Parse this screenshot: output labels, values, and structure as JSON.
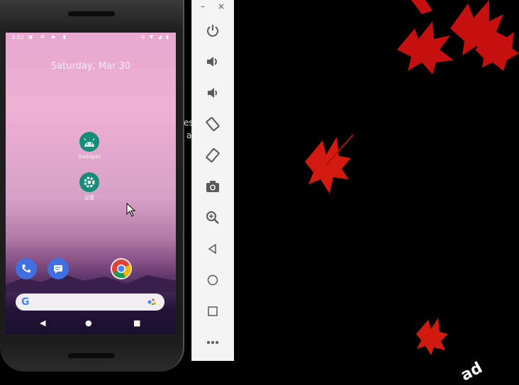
{
  "window": {
    "minimize_label": "–",
    "close_label": "×"
  },
  "desktop": {
    "partial_text_1": "es",
    "partial_text_2": "a",
    "watermark_fragment": "ad",
    "background_color": "#000000",
    "leaf_color": "#d01010"
  },
  "phone": {
    "status": {
      "time": "3:02",
      "left_icons": [
        "notification-icon",
        "settings-icon",
        "play-store-icon",
        "sd-card-icon"
      ],
      "right_icons": [
        "alarm-icon",
        "wifi-icon",
        "signal-icon",
        "battery-icon"
      ]
    },
    "date": "Saturday, Mar 30",
    "apps": [
      {
        "label": "Gadagdo",
        "icon": "android-icon",
        "color": "#168c7a"
      },
      {
        "label": "设置",
        "icon": "settings-gear-icon",
        "color": "#168c7a"
      }
    ],
    "dock": [
      {
        "name": "phone-app",
        "icon": "phone-icon",
        "color": "#3f6fe0"
      },
      {
        "name": "messages-app",
        "icon": "messages-icon",
        "color": "#3f6fe0"
      },
      {
        "name": "chrome-app",
        "icon": "chrome-icon",
        "color": "#e8e8e8"
      }
    ],
    "search": {
      "placeholder": "",
      "google_letter": "G"
    },
    "nav": {
      "back": "◀",
      "home": "●",
      "recents": "■"
    }
  },
  "toolbar": {
    "buttons": [
      "power-icon",
      "volume-up-icon",
      "volume-down-icon",
      "rotate-left-icon",
      "rotate-right-icon",
      "camera-icon",
      "zoom-icon",
      "back-icon",
      "home-icon",
      "overview-icon",
      "more-icon"
    ]
  }
}
